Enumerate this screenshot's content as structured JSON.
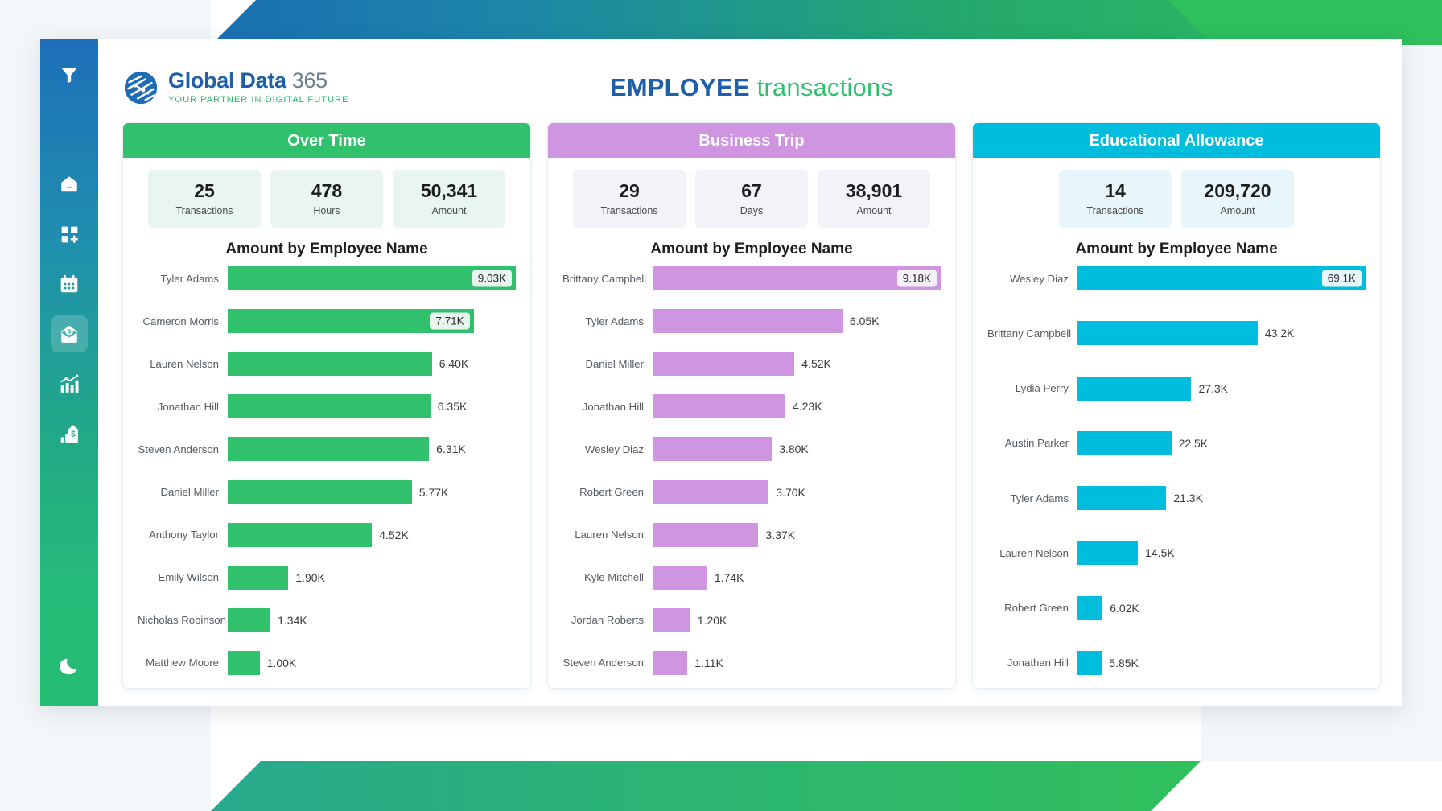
{
  "header": {
    "logo_name_bold": "Global Data",
    "logo_365": "365",
    "logo_tagline": "YOUR PARTNER IN DIGITAL FUTURE",
    "title_part1": "EMPLOYEE",
    "title_part2": "transactions"
  },
  "sidebar": {
    "items": [
      {
        "icon": "filter-icon",
        "name": "sidebar-item-filter",
        "active": false
      },
      {
        "icon": "home-icon",
        "name": "sidebar-item-home",
        "active": false
      },
      {
        "icon": "add-widget-icon",
        "name": "sidebar-item-add-widget",
        "active": false
      },
      {
        "icon": "calendar-icon",
        "name": "sidebar-item-calendar",
        "active": false
      },
      {
        "icon": "payment-envelope-icon",
        "name": "sidebar-item-payments",
        "active": true
      },
      {
        "icon": "analytics-chart-icon",
        "name": "sidebar-item-analytics",
        "active": false
      },
      {
        "icon": "revenue-building-icon",
        "name": "sidebar-item-revenue",
        "active": false
      },
      {
        "icon": "dark-mode-moon-icon",
        "name": "sidebar-item-dark-mode",
        "active": false
      }
    ]
  },
  "colors": {
    "over_time": "#31c16c",
    "business_trip": "#cf95e0",
    "educational_allowance": "#00bcdd",
    "over_time_kpi_bg": "#e9f6ef",
    "business_trip_kpi_bg": "#f4f1f9",
    "educational_kpi_bg": "#e7f6fa",
    "brand_blue": "#1f5fa9",
    "brand_green": "#2fbf6e"
  },
  "cards": [
    {
      "title": "Over Time",
      "accent": "#31c16c",
      "kpi_bg": "#e9f6ef",
      "kpis": [
        {
          "value": "25",
          "label": "Transactions"
        },
        {
          "value": "478",
          "label": "Hours"
        },
        {
          "value": "50,341",
          "label": "Amount"
        }
      ],
      "chart_title": "Amount by Employee Name"
    },
    {
      "title": "Business Trip",
      "accent": "#cf95e0",
      "kpi_bg": "#f4f1f9",
      "kpis": [
        {
          "value": "29",
          "label": "Transactions"
        },
        {
          "value": "67",
          "label": "Days"
        },
        {
          "value": "38,901",
          "label": "Amount"
        }
      ],
      "chart_title": "Amount by Employee Name"
    },
    {
      "title": "Educational Allowance",
      "accent": "#00bcdd",
      "kpi_bg": "#e7f6fa",
      "kpis": [
        {
          "value": "14",
          "label": "Transactions"
        },
        {
          "value": "209,720",
          "label": "Amount"
        }
      ],
      "chart_title": "Amount by Employee Name"
    }
  ],
  "chart_data": [
    {
      "type": "bar",
      "orientation": "horizontal",
      "title": "Amount by Employee Name",
      "panel": "Over Time",
      "color": "#31c16c",
      "xlabel": "",
      "ylabel": "Employee Name",
      "xlim": [
        0,
        9030
      ],
      "grid": false,
      "legend": "none",
      "categories": [
        "Tyler Adams",
        "Cameron Morris",
        "Lauren Nelson",
        "Jonathan Hill",
        "Steven Anderson",
        "Daniel Miller",
        "Anthony Taylor",
        "Emily Wilson",
        "Nicholas Robinson",
        "Matthew Moore"
      ],
      "values": [
        9030,
        7710,
        6400,
        6350,
        6310,
        5770,
        4520,
        1900,
        1340,
        1000
      ],
      "labels": [
        "9.03K",
        "7.71K",
        "6.40K",
        "6.35K",
        "6.31K",
        "5.77K",
        "4.52K",
        "1.90K",
        "1.34K",
        "1.00K"
      ],
      "labels_inside": [
        true,
        true,
        false,
        false,
        false,
        false,
        false,
        false,
        false,
        false
      ]
    },
    {
      "type": "bar",
      "orientation": "horizontal",
      "title": "Amount by Employee Name",
      "panel": "Business Trip",
      "color": "#cf95e0",
      "xlabel": "",
      "ylabel": "Employee Name",
      "xlim": [
        0,
        9180
      ],
      "grid": false,
      "legend": "none",
      "categories": [
        "Brittany Campbell",
        "Tyler Adams",
        "Daniel Miller",
        "Jonathan Hill",
        "Wesley Diaz",
        "Robert Green",
        "Lauren Nelson",
        "Kyle Mitchell",
        "Jordan Roberts",
        "Steven Anderson"
      ],
      "values": [
        9180,
        6050,
        4520,
        4230,
        3800,
        3700,
        3370,
        1740,
        1200,
        1110
      ],
      "labels": [
        "9.18K",
        "6.05K",
        "4.52K",
        "4.23K",
        "3.80K",
        "3.70K",
        "3.37K",
        "1.74K",
        "1.20K",
        "1.11K"
      ],
      "labels_inside": [
        true,
        false,
        false,
        false,
        false,
        false,
        false,
        false,
        false,
        false
      ]
    },
    {
      "type": "bar",
      "orientation": "horizontal",
      "title": "Amount by Employee Name",
      "panel": "Educational Allowance",
      "color": "#00bcdd",
      "xlabel": "",
      "ylabel": "Employee Name",
      "xlim": [
        0,
        69100
      ],
      "grid": false,
      "legend": "none",
      "categories": [
        "Wesley Diaz",
        "Brittany Campbell",
        "Lydia Perry",
        "Austin Parker",
        "Tyler Adams",
        "Lauren Nelson",
        "Robert Green",
        "Jonathan Hill"
      ],
      "values": [
        69100,
        43200,
        27300,
        22500,
        21300,
        14500,
        6020,
        5850
      ],
      "labels": [
        "69.1K",
        "43.2K",
        "27.3K",
        "22.5K",
        "21.3K",
        "14.5K",
        "6.02K",
        "5.85K"
      ],
      "labels_inside": [
        true,
        false,
        false,
        false,
        false,
        false,
        false,
        false
      ]
    }
  ]
}
